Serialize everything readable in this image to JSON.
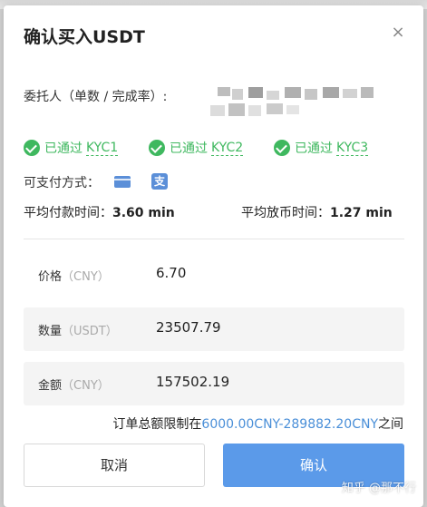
{
  "dialog": {
    "title": "确认买入USDT",
    "close_glyph": "×"
  },
  "trader": {
    "label": "委托人（单数 / 完成率）:"
  },
  "kyc": [
    {
      "prefix": "已通过",
      "level": "KYC1"
    },
    {
      "prefix": "已通过",
      "level": "KYC2"
    },
    {
      "prefix": "已通过",
      "level": "KYC3"
    }
  ],
  "payment": {
    "label": "可支付方式：",
    "methods": [
      "bank-card-icon",
      "alipay-icon"
    ],
    "alipay_glyph": "支"
  },
  "stats": {
    "avg_pay_label": "平均付款时间：",
    "avg_pay_value": "3.60 min",
    "avg_release_label": "平均放币时间：",
    "avg_release_value": "1.27 min"
  },
  "fields": {
    "price": {
      "label": "价格",
      "unit": "（CNY）",
      "value": "6.70"
    },
    "quantity": {
      "label": "数量",
      "unit": "（USDT）",
      "value": "23507.79"
    },
    "amount": {
      "label": "金额",
      "unit": "（CNY）",
      "value": "157502.19"
    }
  },
  "limit": {
    "prefix": "订单总额限制在",
    "range": "6000.00CNY-289882.20CNY",
    "suffix": "之间"
  },
  "buttons": {
    "cancel": "取消",
    "confirm": "确认"
  },
  "watermark": "知乎 @那不行",
  "colors": {
    "accent": "#5b9ae9",
    "success": "#3fb85f",
    "link": "#4a8fd8"
  }
}
